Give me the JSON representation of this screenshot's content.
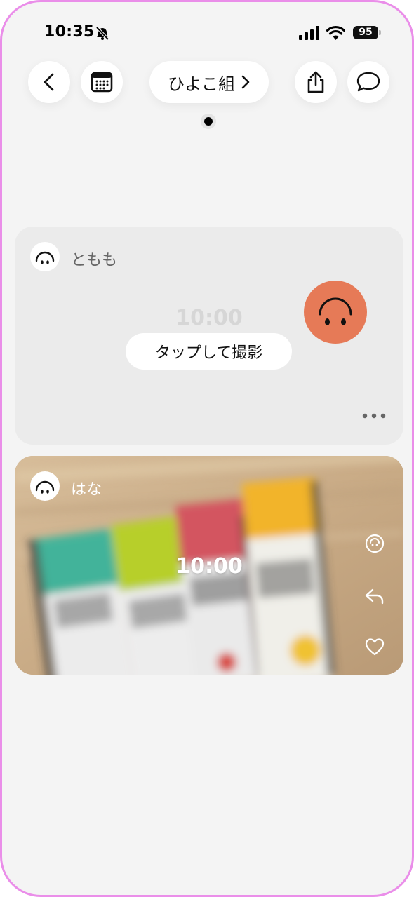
{
  "status_bar": {
    "time": "10:35",
    "battery": "95"
  },
  "nav": {
    "group_name": "ひよこ組",
    "group_chevron": ">"
  },
  "posts": [
    {
      "user": "ともも",
      "clock": "10:00",
      "tap_button": "タップして撮影",
      "avatar_color": "#e67a57"
    },
    {
      "user": "はな",
      "clock": "10:00"
    }
  ],
  "icons": {
    "status": [
      "bell-slash-icon",
      "cellular-signal-icon",
      "wifi-icon",
      "battery-icon"
    ],
    "nav": [
      "chevron-left-icon",
      "calendar-icon",
      "share-icon",
      "chat-bubble-icon"
    ],
    "post_actions": [
      "more-icon",
      "reaction-face-icon",
      "reply-icon",
      "heart-icon"
    ]
  }
}
